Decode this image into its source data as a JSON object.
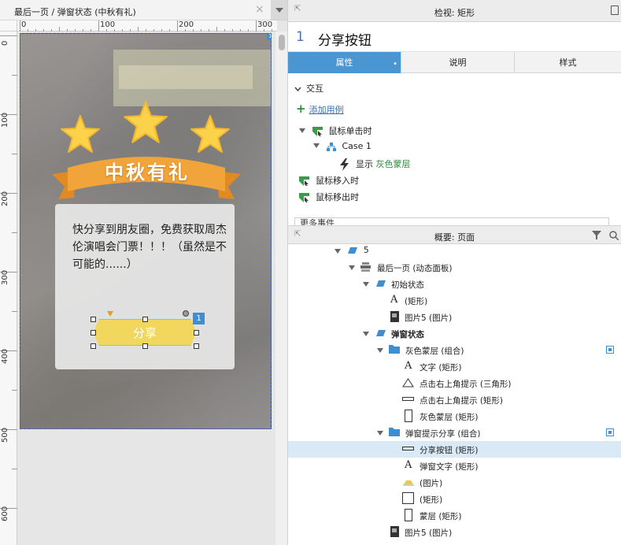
{
  "document": {
    "tab_title": "最后一页 / 弹窗状态 (中秋有礼)",
    "close_glyph": "×"
  },
  "rulers": {
    "horizontal": [
      "0",
      "100",
      "200",
      "300"
    ],
    "vertical": [
      "0",
      "100",
      "200",
      "300",
      "400",
      "500",
      "600"
    ]
  },
  "canvas": {
    "ribbon_text": "中秋有礼",
    "popup_text": "快分享到朋友圈，免费获取周杰伦演唱会门票！！！（虽然是不可能的......）",
    "share_button_label": "分享",
    "badge_number": "1",
    "corner_badge": "1"
  },
  "inspector": {
    "header_title": "检视: 矩形",
    "widget_number": "1",
    "widget_name": "分享按钮",
    "tabs": [
      {
        "label": "属性",
        "active": true
      },
      {
        "label": "说明",
        "active": false
      },
      {
        "label": "样式",
        "active": false
      }
    ],
    "section_title": "交互",
    "add_use_case": "添加用例",
    "events": {
      "click": "鼠标单击时",
      "case": "Case 1",
      "action_prefix": "显示",
      "action_target": "灰色蒙层",
      "mouse_enter": "鼠标移入时",
      "mouse_leave": "鼠标移出时"
    },
    "more_events": "更多事件"
  },
  "outline": {
    "header_title": "概要: 页面",
    "rows": [
      {
        "label": "5"
      },
      {
        "label": "最后一页 (动态面板)"
      },
      {
        "label": "初始状态"
      },
      {
        "label": "(矩形)"
      },
      {
        "label": "图片5 (图片)"
      },
      {
        "label": "弹窗状态"
      },
      {
        "label": "灰色蒙层 (组合)"
      },
      {
        "label": "文字 (矩形)"
      },
      {
        "label": "点击右上角提示 (三角形)"
      },
      {
        "label": "点击右上角提示 (矩形)"
      },
      {
        "label": "灰色蒙层 (矩形)"
      },
      {
        "label": "弹窗提示分享 (组合)"
      },
      {
        "label": "分享按钮 (矩形)"
      },
      {
        "label": "弹窗文字 (矩形)"
      },
      {
        "label": "(图片)"
      },
      {
        "label": "(矩形)"
      },
      {
        "label": "蒙层 (矩形)"
      },
      {
        "label": "图片5 (图片)"
      }
    ]
  },
  "colors": {
    "accent_blue": "#4a96d2",
    "green_text": "#2e8b3a",
    "selection_bg": "#d9e9f5",
    "button_yellow": "#f2d75e",
    "ribbon_orange": "#f0a43a"
  }
}
